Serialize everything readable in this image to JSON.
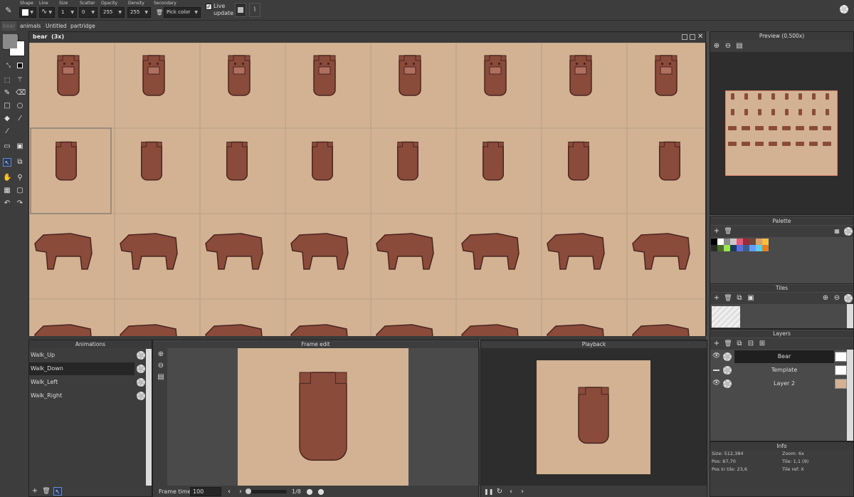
{
  "toolbar": {
    "shape_label": "Shape",
    "line_label": "Line",
    "size_label": "Size",
    "size_value": "1",
    "scatter_label": "Scatter",
    "scatter_value": "0",
    "opacity_label": "Opacity",
    "opacity_value": "255",
    "density_label": "Density",
    "density_value": "255",
    "secondary_label": "Secondary",
    "secondary_value": "Pick color",
    "live_update_label": "Live update",
    "live_update_checked": true
  },
  "doc_tabs": [
    "bear",
    "animals",
    "Untitled",
    "partridge"
  ],
  "canvas": {
    "title": "bear  (3x)",
    "background": "#d2b292",
    "bear_color": "#8a4b3b"
  },
  "animations": {
    "title": "Animations",
    "items": [
      "Walk_Up",
      "Walk_Down",
      "Walk_Left",
      "Walk_Right"
    ],
    "selected_index": 1
  },
  "frame_edit": {
    "title": "Frame edit",
    "frame_time_label": "Frame time",
    "frame_time_value": "100",
    "frame_counter": "1/8"
  },
  "playback": {
    "title": "Playback"
  },
  "preview": {
    "title": "Preview (0.500x)"
  },
  "palette": {
    "title": "Palette",
    "colors": [
      "#000000",
      "#ffffff",
      "#8a8a8a",
      "#c8c8c8",
      "#e35c7c",
      "#9b2a3c",
      "#6b4a3a",
      "#d9a066",
      "#f6c043",
      "#2a2a2a",
      "#4b6b2a",
      "#99e550",
      "#1e3a5a",
      "#5b6ee1",
      "#3a5f8a",
      "#639bff",
      "#5fcde4",
      "#e67e22"
    ]
  },
  "tiles": {
    "title": "Tiles"
  },
  "layers": {
    "title": "Layers",
    "items": [
      "Bear",
      "Template",
      "Layer 2"
    ],
    "selected_index": 0
  },
  "info": {
    "title": "Info",
    "size": "Size: 512,384",
    "pos": "Pos: 87,70",
    "pos_in_tile": "Pos in tile: 23,6",
    "zoom": "Zoom: 6x",
    "tile": "Tile: 1,1 (9)",
    "tile_ref": "Tile ref: X"
  }
}
